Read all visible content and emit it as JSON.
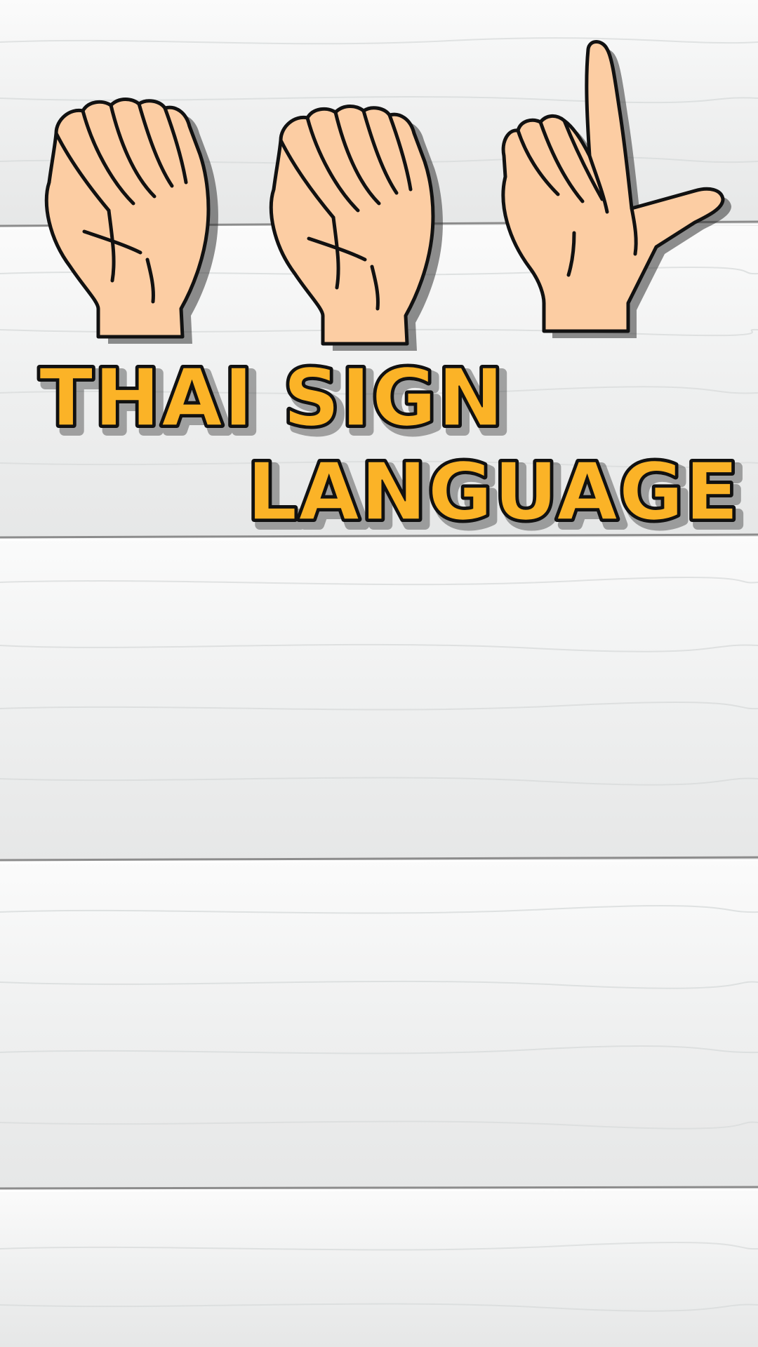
{
  "title": {
    "line1": "THAI SIGN",
    "line2": "LANGUAGE"
  },
  "colors": {
    "title_fill": "#fbb327",
    "title_outline": "#111111",
    "skin": "#fccda3",
    "skin_outline": "#111111",
    "wood": "#f3f4f4",
    "plank_gap": "#8c8c8c"
  },
  "icons": {
    "hand_1": "fist-hand-sign-icon",
    "hand_2": "fist-hand-sign-icon",
    "hand_3": "index-thumb-l-hand-sign-icon"
  }
}
